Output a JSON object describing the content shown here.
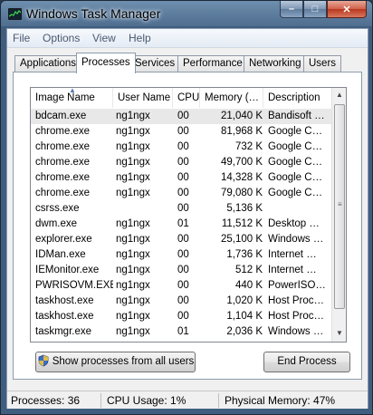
{
  "window": {
    "title": "Windows Task Manager",
    "caption": {
      "minimize": "–",
      "maximize": "□",
      "close": "✕"
    }
  },
  "menu": [
    "File",
    "Options",
    "View",
    "Help"
  ],
  "tabs": [
    "Applications",
    "Processes",
    "Services",
    "Performance",
    "Networking",
    "Users"
  ],
  "active_tab": "Processes",
  "columns": [
    "Image Name",
    "User Name",
    "CPU",
    "Memory (…",
    "Description"
  ],
  "sorted_column": "Image Name",
  "processes": [
    {
      "name": "bdcam.exe",
      "user": "ng1ngx",
      "cpu": "00",
      "mem": "21,040 K",
      "desc": "Bandisoft …",
      "selected": true
    },
    {
      "name": "chrome.exe",
      "user": "ng1ngx",
      "cpu": "00",
      "mem": "81,968 K",
      "desc": "Google C…"
    },
    {
      "name": "chrome.exe",
      "user": "ng1ngx",
      "cpu": "00",
      "mem": "732 K",
      "desc": "Google C…"
    },
    {
      "name": "chrome.exe",
      "user": "ng1ngx",
      "cpu": "00",
      "mem": "49,700 K",
      "desc": "Google C…"
    },
    {
      "name": "chrome.exe",
      "user": "ng1ngx",
      "cpu": "00",
      "mem": "14,328 K",
      "desc": "Google C…"
    },
    {
      "name": "chrome.exe",
      "user": "ng1ngx",
      "cpu": "00",
      "mem": "79,080 K",
      "desc": "Google C…"
    },
    {
      "name": "csrss.exe",
      "user": "",
      "cpu": "00",
      "mem": "5,136 K",
      "desc": ""
    },
    {
      "name": "dwm.exe",
      "user": "ng1ngx",
      "cpu": "01",
      "mem": "11,512 K",
      "desc": "Desktop …"
    },
    {
      "name": "explorer.exe",
      "user": "ng1ngx",
      "cpu": "00",
      "mem": "25,100 K",
      "desc": "Windows …"
    },
    {
      "name": "IDMan.exe",
      "user": "ng1ngx",
      "cpu": "00",
      "mem": "1,736 K",
      "desc": "Internet …"
    },
    {
      "name": "IEMonitor.exe",
      "user": "ng1ngx",
      "cpu": "00",
      "mem": "512 K",
      "desc": "Internet …"
    },
    {
      "name": "PWRISOVM.EXE",
      "user": "ng1ngx",
      "cpu": "00",
      "mem": "440 K",
      "desc": "PowerISO…"
    },
    {
      "name": "taskhost.exe",
      "user": "ng1ngx",
      "cpu": "00",
      "mem": "1,020 K",
      "desc": "Host Proc…"
    },
    {
      "name": "taskhost.exe",
      "user": "ng1ngx",
      "cpu": "00",
      "mem": "1,104 K",
      "desc": "Host Proc…"
    },
    {
      "name": "taskmgr.exe",
      "user": "ng1ngx",
      "cpu": "01",
      "mem": "2,036 K",
      "desc": "Windows …"
    }
  ],
  "buttons": {
    "show_all": "Show processes from all users",
    "end_process": "End Process"
  },
  "status": {
    "processes": "Processes: 36",
    "cpu": "CPU Usage: 1%",
    "memory": "Physical Memory: 47%"
  },
  "colors": {
    "frame": "#4e6d8f",
    "close_button": "#c4472c",
    "selected_row": "#e8e8e8"
  }
}
